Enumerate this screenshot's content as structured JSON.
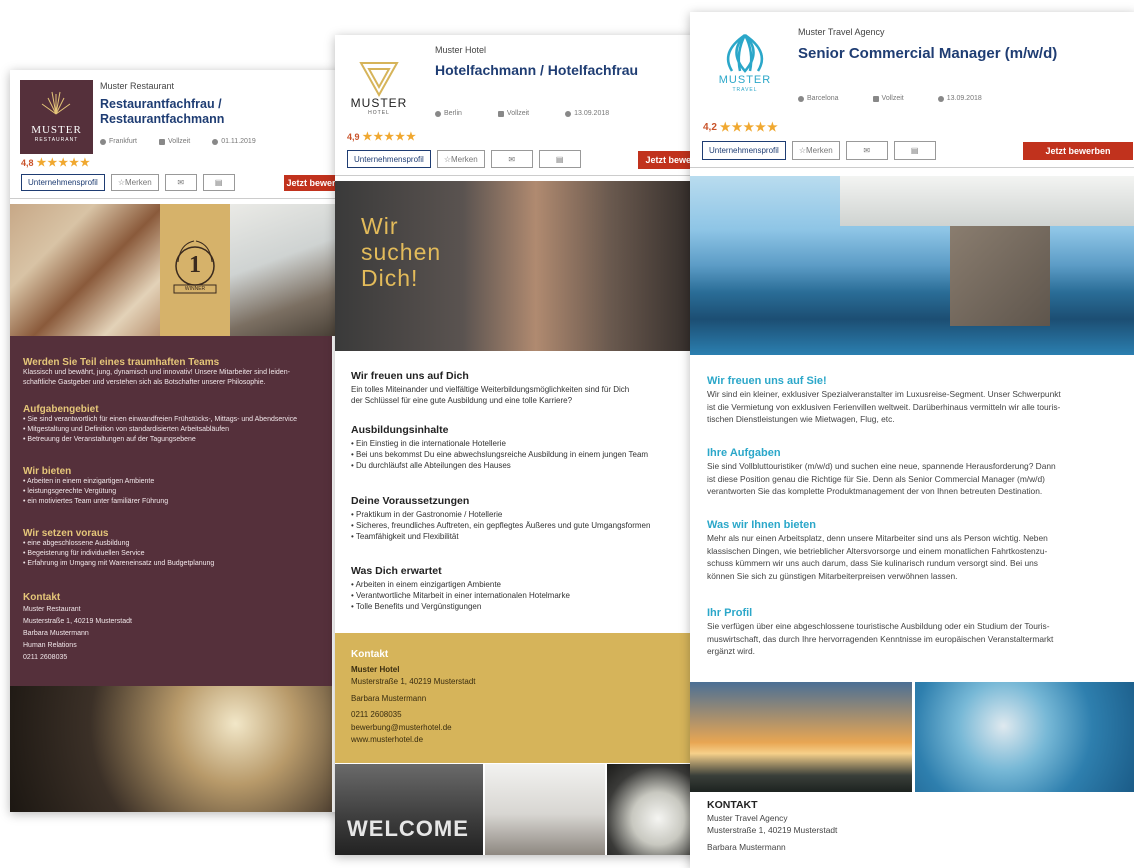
{
  "cards": [
    {
      "company": "Muster Restaurant",
      "title": "Restaurantfachfrau / Restaurantfachmann",
      "logo": {
        "line1": "MUSTER",
        "line2": "RESTAURANT"
      },
      "meta": {
        "location": "Frankfurt",
        "type": "Vollzeit",
        "date": "01.11.2019"
      },
      "rating": "4,8",
      "buttons": {
        "profile": "Unternehmensprofil",
        "save": "Merken",
        "apply": "Jetzt bewerben"
      },
      "badge": {
        "number": "1",
        "label": "WINNER"
      },
      "sections": [
        {
          "title": "Werden Sie Teil eines traumhaften Teams",
          "lines": [
            "Klassisch und bewährt, jung, dynamisch und innovativ! Unsere Mitarbeiter sind leiden-",
            "schaftliche Gastgeber und verstehen sich als Botschafter unserer Philosophie."
          ]
        },
        {
          "title": "Aufgabengebiet",
          "lines": [
            "• Sie sind verantwortlich für einen einwandfreien Frühstücks-, Mittags- und Abendservice",
            "• Mitgestaltung und Definition von standardisierten Arbeitsabläufen",
            "• Betreuung der Veranstaltungen auf der Tagungsebene"
          ]
        },
        {
          "title": "Wir bieten",
          "lines": [
            "• Arbeiten in einem einzigartigen Ambiente",
            "• leistungsgerechte Vergütung",
            "• ein motiviertes Team unter familiärer Führung"
          ]
        },
        {
          "title": "Wir setzen voraus",
          "lines": [
            "• eine abgeschlossene Ausbildung",
            "• Begeisterung für individuellen Service",
            "• Erfahrung im Umgang mit Wareneinsatz und Budgetplanung"
          ]
        },
        {
          "title": "Kontakt",
          "lines": [
            "Muster Restaurant",
            "Musterstraße 1, 40219 Musterstadt",
            "Barbara Mustermann",
            "Human Relations",
            "0211 2608035"
          ]
        }
      ]
    },
    {
      "company": "Muster Hotel",
      "title": "Hotelfachmann / Hotelfachfrau",
      "logo": {
        "line1": "MUSTER",
        "line2": "HOTEL"
      },
      "meta": {
        "location": "Berlin",
        "type": "Vollzeit",
        "date": "13.09.2018"
      },
      "rating": "4,9",
      "buttons": {
        "profile": "Unternehmensprofil",
        "save": "Merken",
        "apply": "Jetzt bewerben"
      },
      "hero_text": [
        "Wir",
        "suchen",
        "Dich!"
      ],
      "sections": [
        {
          "title": "Wir freuen uns auf Dich",
          "lines": [
            "Ein tolles Miteinander und vielfältige Weiterbildungsmöglichkeiten sind für Dich",
            "der Schlüssel für eine gute Ausbildung und eine tolle Karriere?"
          ]
        },
        {
          "title": "Ausbildungsinhalte",
          "lines": [
            "• Ein Einstieg in die internationale Hotellerie",
            "• Bei uns bekommst Du eine abwechslungsreiche Ausbildung in einem jungen Team",
            "• Du durchläufst alle Abteilungen des Hauses"
          ]
        },
        {
          "title": "Deine Voraussetzungen",
          "lines": [
            "• Praktikum in der Gastronomie / Hotellerie",
            "• Sicheres, freundliches Auftreten, ein gepflegtes Äußeres und gute Umgangsformen",
            "• Teamfähigkeit und Flexibilität"
          ]
        },
        {
          "title": "Was Dich erwartet",
          "lines": [
            "• Arbeiten in einem einzigartigen Ambiente",
            "• Verantwortliche Mitarbeit in einer internationalen Hotelmarke",
            "• Tolle Benefits und Vergünstigungen"
          ]
        }
      ],
      "contact": {
        "title": "Kontakt",
        "name": "Muster Hotel",
        "lines": [
          "Musterstraße 1, 40219 Musterstadt",
          "Barbara Mustermann",
          "0211 2608035",
          "bewerbung@musterhotel.de",
          "www.musterhotel.de"
        ]
      },
      "welcome": "WELCOME"
    },
    {
      "company": "Muster Travel Agency",
      "title": "Senior Commercial Manager (m/w/d)",
      "logo": {
        "line1": "MUSTER",
        "line2": "TRAVEL"
      },
      "meta": {
        "location": "Barcelona",
        "type": "Vollzeit",
        "date": "13.09.2018"
      },
      "rating": "4,2",
      "buttons": {
        "profile": "Unternehmensprofil",
        "save": "Merken",
        "apply": "Jetzt bewerben"
      },
      "sections": [
        {
          "title": "Wir freuen uns auf Sie!",
          "lines": [
            "Wir sind ein kleiner, exklusiver Spezialveranstalter im Luxusreise-Segment. Unser Schwerpunkt",
            "ist die Vermietung von exklusiven Ferienvillen weltweit. Darüberhinaus vermitteln wir alle touris-",
            "tischen Dienstleistungen wie Mietwagen, Flug, etc."
          ]
        },
        {
          "title": "Ihre Aufgaben",
          "lines": [
            "Sie sind Vollbluttouristiker (m/w/d) und suchen eine neue, spannende Herausforderung? Dann",
            "ist diese Position genau die Richtige für Sie. Denn als Senior Commercial Manager (m/w/d)",
            "verantworten Sie das komplette Produktmanagement der von Ihnen betreuten Destination."
          ]
        },
        {
          "title": "Was wir Ihnen bieten",
          "lines": [
            "Mehr als nur einen Arbeitsplatz, denn unsere Mitarbeiter sind uns als Person wichtig. Neben",
            "klassischen Dingen, wie betrieblicher Altersvorsorge und einem monatlichen Fahrtkostenzu-",
            "schuss kümmern wir uns auch darum, dass Sie kulinarisch rundum versorgt sind. Bei uns",
            "können Sie sich zu günstigen Mitarbeiterpreisen verwöhnen lassen."
          ]
        },
        {
          "title": "Ihr Profil",
          "lines": [
            "Sie verfügen über eine abgeschlossene touristische Ausbildung oder ein Studium der Touris-",
            "muswirtschaft, das durch Ihre hervorragenden Kenntnisse im europäischen Veranstaltermarkt",
            "ergänzt wird."
          ]
        }
      ],
      "contact": {
        "title": "KONTAKT",
        "lines": [
          "Muster Travel Agency",
          "Musterstraße 1, 40219 Musterstadt",
          "Barbara Mustermann"
        ]
      }
    }
  ],
  "colors": {
    "navy": "#1f3d73",
    "apply_red": "#c1321d",
    "restaurant_bg": "#55303b",
    "restaurant_gold": "#e5c679",
    "hotel_gold": "#d6b45a",
    "travel_teal": "#2ba7c9",
    "star": "#f0a830"
  }
}
